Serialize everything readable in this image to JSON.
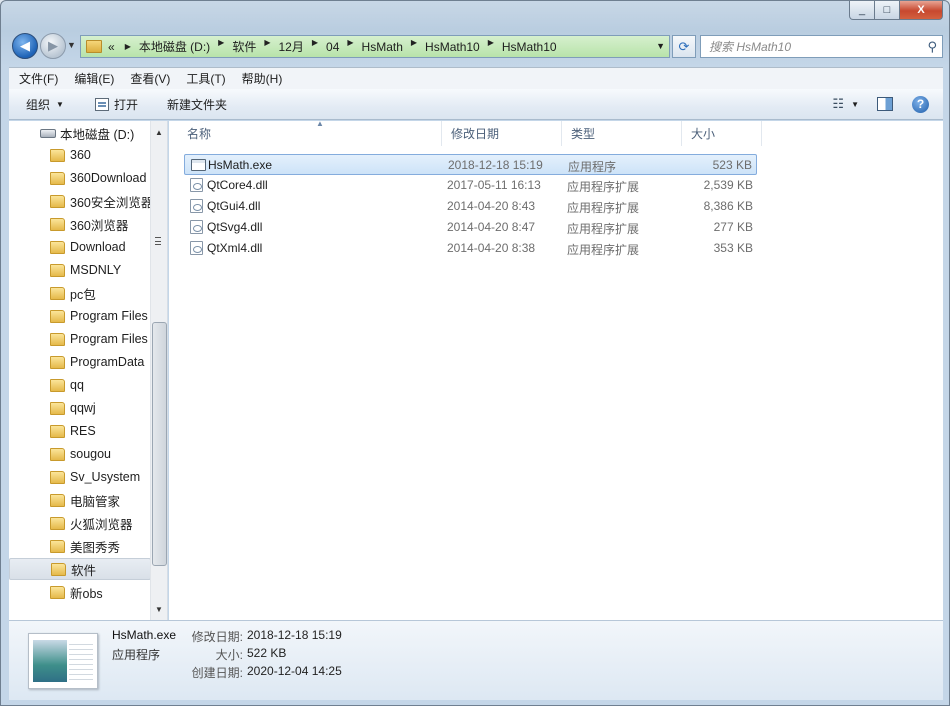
{
  "window": {
    "close_glyph": "X",
    "maximize_glyph": "□",
    "minimize_glyph": "_"
  },
  "nav": {
    "back_glyph": "◀",
    "forward_glyph": "▶",
    "breadcrumb": [
      "本地磁盘 (D:)",
      "软件",
      "12月",
      "04",
      "HsMath",
      "HsMath10",
      "HsMath10"
    ],
    "breadcrumb_more": "«",
    "search_placeholder": "搜索 HsMath10"
  },
  "menu": [
    "文件(F)",
    "编辑(E)",
    "查看(V)",
    "工具(T)",
    "帮助(H)"
  ],
  "toolbar": {
    "organize": "组织",
    "open": "打开",
    "new_folder": "新建文件夹"
  },
  "tree": {
    "drive": "本地磁盘 (D:)",
    "folders": [
      "360",
      "360Download",
      "360安全浏览器",
      "360浏览器",
      "Download",
      "MSDNLY",
      "pc包",
      "Program Files",
      "Program Files",
      "ProgramData",
      "qq",
      "qqwj",
      "RES",
      "sougou",
      "Sv_Usystem",
      "电脑管家",
      "火狐浏览器",
      "美图秀秀",
      "软件",
      "新obs"
    ],
    "selected_folder": "软件"
  },
  "columns": {
    "name": "名称",
    "date": "修改日期",
    "type": "类型",
    "size": "大小"
  },
  "files": [
    {
      "name": "HsMath.exe",
      "date": "2018-12-18 15:19",
      "type": "应用程序",
      "size": "523 KB",
      "icon": "exe-icon",
      "selected": true
    },
    {
      "name": "QtCore4.dll",
      "date": "2017-05-11 16:13",
      "type": "应用程序扩展",
      "size": "2,539 KB",
      "icon": "dll-icon",
      "selected": false
    },
    {
      "name": "QtGui4.dll",
      "date": "2014-04-20 8:43",
      "type": "应用程序扩展",
      "size": "8,386 KB",
      "icon": "dll-icon",
      "selected": false
    },
    {
      "name": "QtSvg4.dll",
      "date": "2014-04-20 8:47",
      "type": "应用程序扩展",
      "size": "277 KB",
      "icon": "dll-icon",
      "selected": false
    },
    {
      "name": "QtXml4.dll",
      "date": "2014-04-20 8:38",
      "type": "应用程序扩展",
      "size": "353 KB",
      "icon": "dll-icon",
      "selected": false
    }
  ],
  "details": {
    "name": "HsMath.exe",
    "type": "应用程序",
    "modified_label": "修改日期:",
    "modified": "2018-12-18 15:19",
    "size_label": "大小:",
    "size": "522 KB",
    "created_label": "创建日期:",
    "created": "2020-12-04 14:25"
  }
}
